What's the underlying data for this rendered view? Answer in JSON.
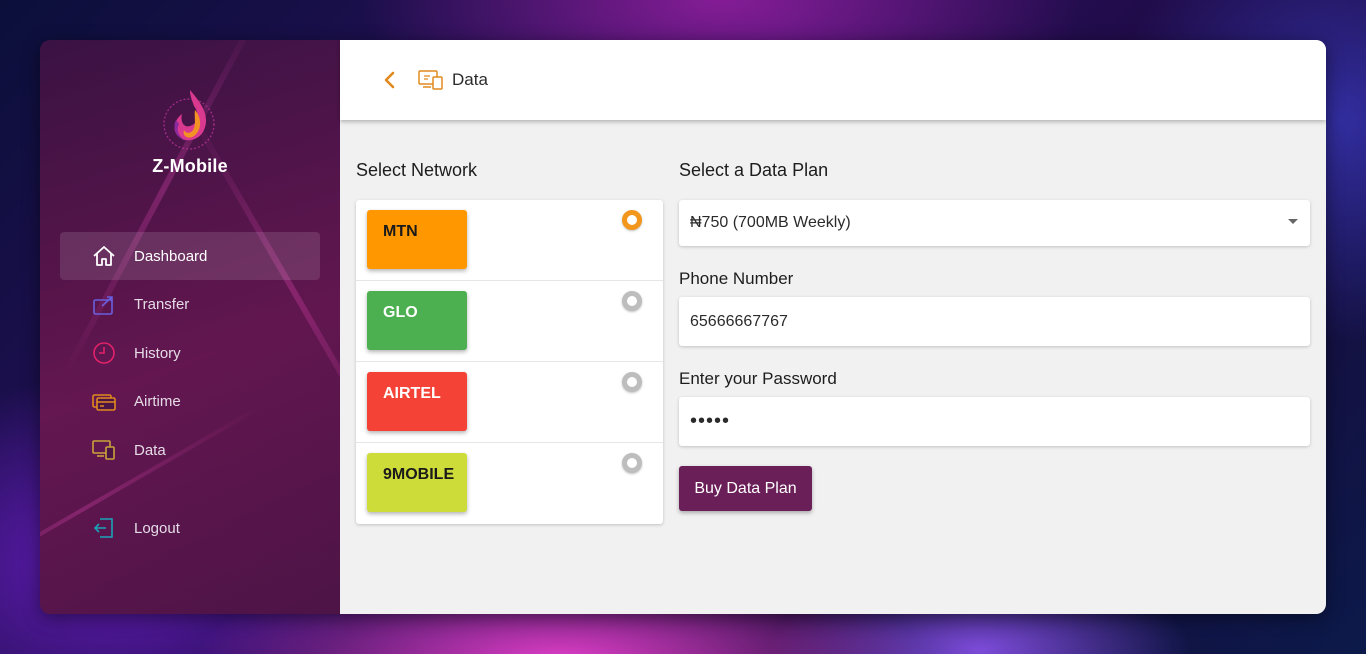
{
  "sidebar": {
    "brand": "Z-Mobile",
    "items": [
      {
        "label": "Dashboard",
        "icon": "home-icon",
        "active": true
      },
      {
        "label": "Transfer",
        "icon": "transfer-icon"
      },
      {
        "label": "History",
        "icon": "clock-icon"
      },
      {
        "label": "Airtime",
        "icon": "card-icon"
      },
      {
        "label": "Data",
        "icon": "devices-icon"
      }
    ],
    "logout": {
      "label": "Logout",
      "icon": "logout-icon"
    }
  },
  "header": {
    "title": "Data",
    "back_icon": "chevron-left-icon",
    "page_icon": "devices-icon"
  },
  "networks": {
    "title": "Select Network",
    "items": [
      {
        "label": "MTN",
        "color": "#ff9800",
        "text_color": "#1a1a1a",
        "selected": true
      },
      {
        "label": "GLO",
        "color": "#4caf50",
        "text_color": "#ffffff",
        "selected": false
      },
      {
        "label": "AIRTEL",
        "color": "#f44336",
        "text_color": "#ffffff",
        "selected": false
      },
      {
        "label": "9MOBILE",
        "color": "#cddc39",
        "text_color": "#1a1a1a",
        "selected": false
      }
    ]
  },
  "form": {
    "plan_label": "Select a Data Plan",
    "plan_value": "₦750 (700MB Weekly)",
    "phone_label": "Phone Number",
    "phone_value": "65666667767",
    "password_label": "Enter your Password",
    "password_value": "•••••",
    "submit_label": "Buy Data Plan"
  },
  "colors": {
    "accent": "#e08a1e",
    "button": "#6b1f58",
    "radio_selected": "#f2961c"
  }
}
